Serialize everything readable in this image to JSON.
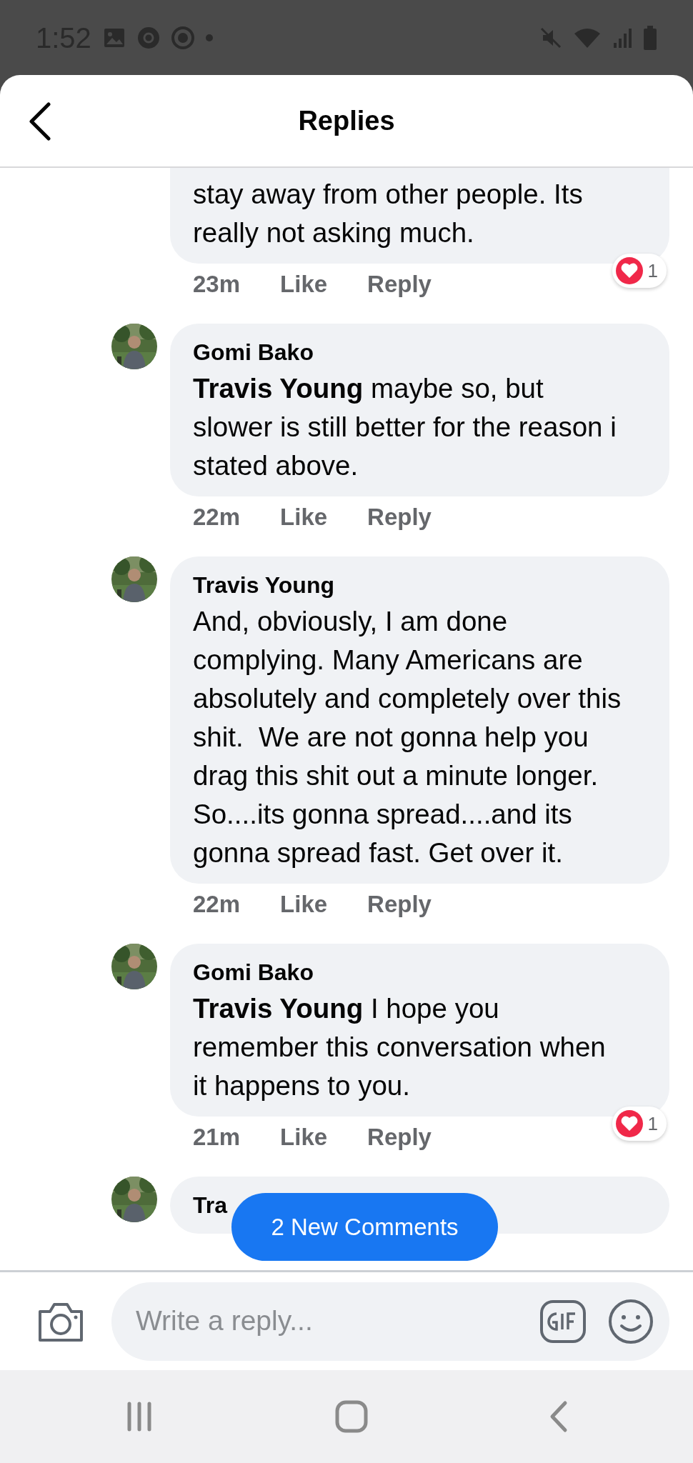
{
  "status_bar": {
    "time": "1:52"
  },
  "header": {
    "title": "Replies"
  },
  "comments": [
    {
      "text": "stay away from other people. Its really not asking much.",
      "time": "23m",
      "like": "Like",
      "reply": "Reply",
      "reactions": "1",
      "cut_top": true
    },
    {
      "author": "Gomi Bako",
      "text": "**Travis Young** maybe so, but slower is still better for the reason i stated above.",
      "time": "22m",
      "like": "Like",
      "reply": "Reply"
    },
    {
      "author": "Travis Young",
      "text": "And, obviously, I am done complying. Many Americans are absolutely and completely over this shit.  We are not gonna help you drag this shit out a minute longer.  So....its gonna spread....and its gonna spread fast. Get over it.",
      "time": "22m",
      "like": "Like",
      "reply": "Reply"
    },
    {
      "author": "Gomi Bako",
      "text": "**Travis Young** I hope you remember this conversation when it happens to you.",
      "time": "21m",
      "like": "Like",
      "reply": "Reply",
      "reactions": "1"
    },
    {
      "author": "Tra"
    }
  ],
  "new_comments_button": "2 New Comments",
  "composer": {
    "placeholder": "Write a reply..."
  }
}
